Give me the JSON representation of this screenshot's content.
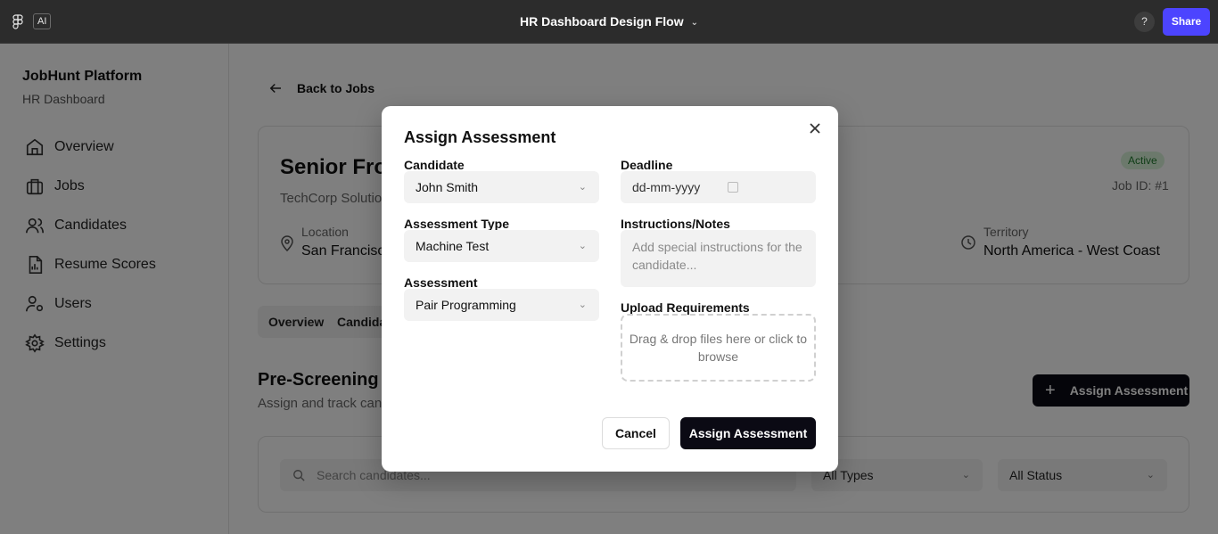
{
  "topbar": {
    "ai_badge": "AI",
    "title": "HR Dashboard Design Flow",
    "help": "?",
    "share": "Share"
  },
  "sidebar": {
    "brand": "JobHunt Platform",
    "subtitle": "HR Dashboard",
    "items": [
      {
        "label": "Overview",
        "icon": "home-icon"
      },
      {
        "label": "Jobs",
        "icon": "briefcase-icon"
      },
      {
        "label": "Candidates",
        "icon": "users-icon"
      },
      {
        "label": "Resume Scores",
        "icon": "chart-icon"
      },
      {
        "label": "Users",
        "icon": "user-settings-icon"
      },
      {
        "label": "Settings",
        "icon": "gear-icon"
      }
    ]
  },
  "main": {
    "back": "Back to Jobs",
    "job": {
      "title": "Senior Front",
      "company": "TechCorp Solutio",
      "location_label": "Location",
      "location_value": "San Francisco",
      "status": "Active",
      "job_id": "Job ID: #1",
      "territory_label": "Territory",
      "territory_value": "North America - West Coast"
    },
    "tabs": [
      "Overview",
      "Candida"
    ],
    "section": {
      "title": "Pre-Screening A",
      "subtitle": "Assign and track can",
      "assign_button": "Assign Assessment"
    },
    "filters": {
      "search_placeholder": "Search candidates...",
      "type": "All Types",
      "status": "All Status"
    }
  },
  "modal": {
    "title": "Assign Assessment",
    "candidate_label": "Candidate",
    "candidate_value": "John Smith",
    "type_label": "Assessment Type",
    "type_value": "Machine Test",
    "assessment_label": "Assessment",
    "assessment_value": "Pair Programming",
    "deadline_label": "Deadline",
    "deadline_value": "dd-mm-yyyy",
    "notes_label": "Instructions/Notes",
    "notes_placeholder": "Add special instructions for the candidate...",
    "upload_label": "Upload Requirements",
    "upload_text": "Drag & drop files here or click to browse",
    "cancel": "Cancel",
    "submit": "Assign Assessment"
  },
  "colors": {
    "topbar": "#2c2c2c",
    "share": "#4c44ff",
    "primary_button": "#0b0a14",
    "active_badge_bg": "#d8f2d9",
    "active_badge_text": "#1f7a2c"
  }
}
